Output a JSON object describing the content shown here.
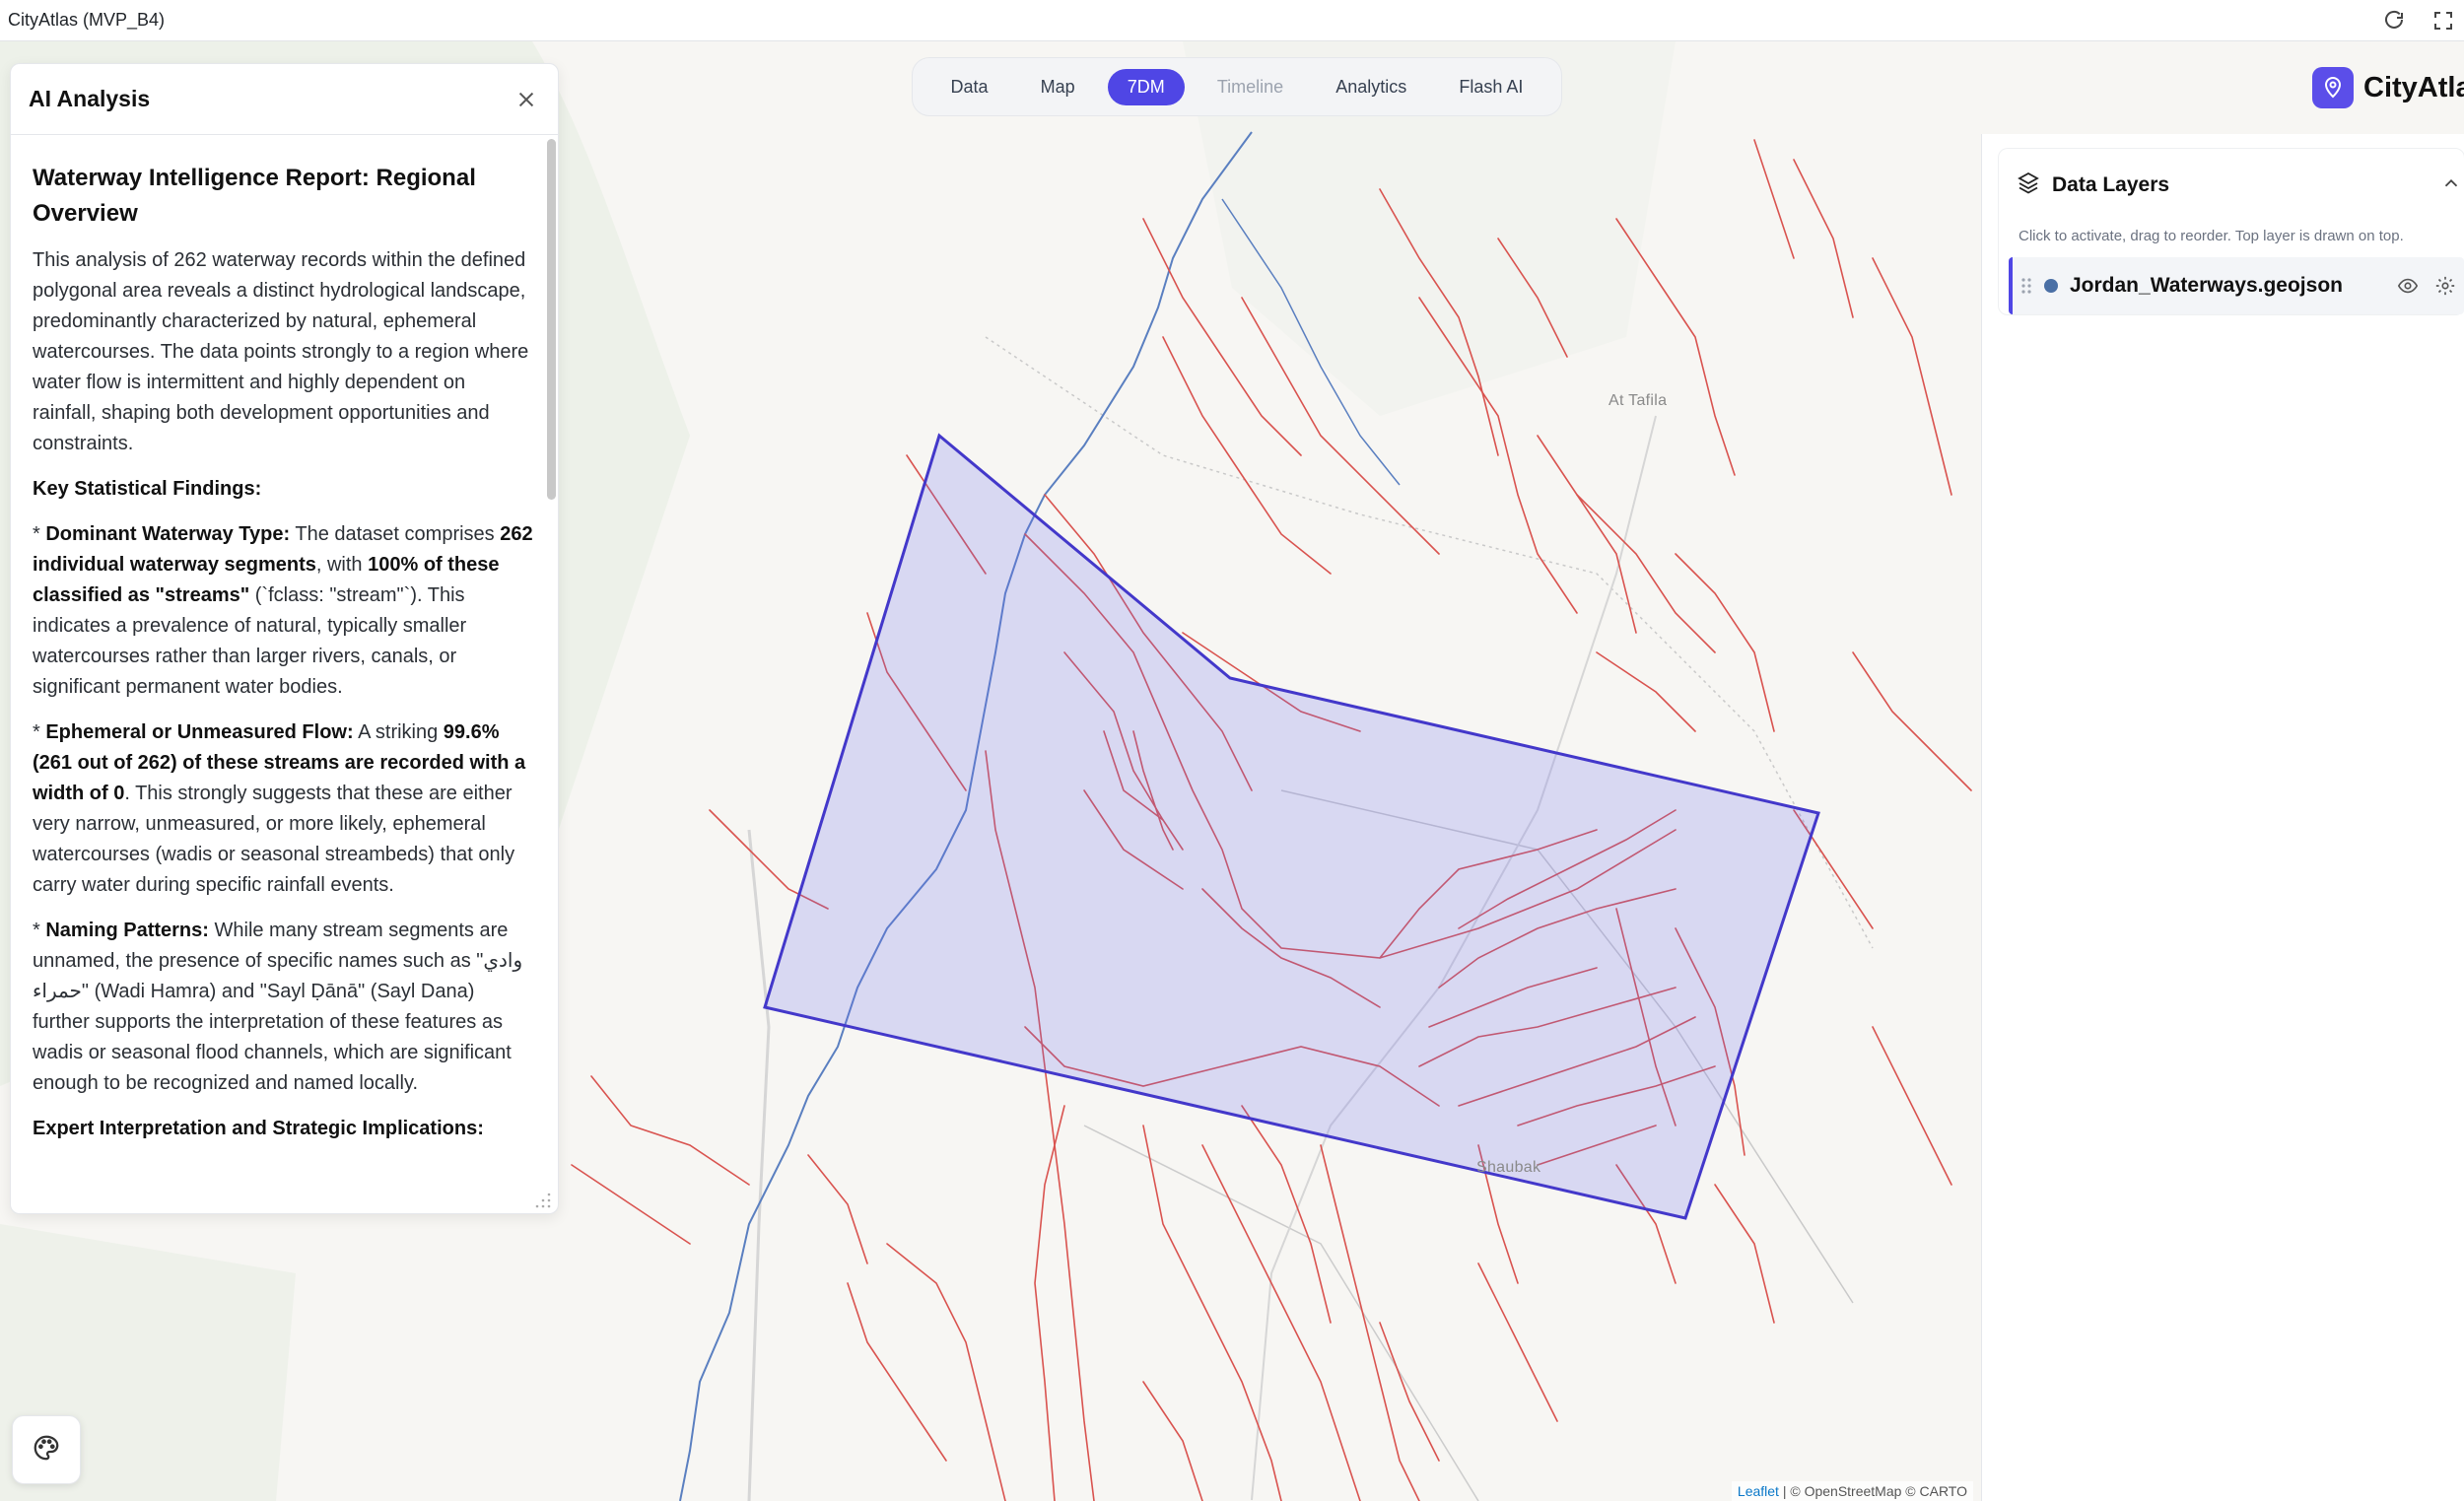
{
  "window": {
    "title": "CityAtlas (MVP_B4)"
  },
  "nav": {
    "tabs": [
      {
        "label": "Data"
      },
      {
        "label": "Map"
      },
      {
        "label": "7DM"
      },
      {
        "label": "Timeline"
      },
      {
        "label": "Analytics"
      },
      {
        "label": "Flash AI"
      }
    ],
    "active": "7DM",
    "disabled": "Timeline"
  },
  "brand": {
    "name": "CityAtlas",
    "accent": "#5b4ee9"
  },
  "ai_panel": {
    "title": "AI Analysis",
    "report_title": "Waterway Intelligence Report: Regional Overview",
    "intro": "This analysis of 262 waterway records within the defined polygonal area reveals a distinct hydrological landscape, predominantly characterized by natural, ephemeral watercourses. The data points strongly to a region where water flow is intermittent and highly dependent on rainfall, shaping both development opportunities and constraints.",
    "findings_heading": "Key Statistical Findings:",
    "finding1_label": "Dominant Waterway Type:",
    "finding1_a": " The dataset comprises ",
    "finding1_b": "262 individual waterway segments",
    "finding1_c": ", with ",
    "finding1_d": "100% of these classified as \"streams\"",
    "finding1_e": " (`fclass: \"stream\"`). This indicates a prevalence of natural, typically smaller watercourses rather than larger rivers, canals, or significant permanent water bodies.",
    "finding2_label": "Ephemeral or Unmeasured Flow:",
    "finding2_a": " A striking ",
    "finding2_b": "99.6% (261 out of 262) of these streams are recorded with a width of 0",
    "finding2_c": ". This strongly suggests that these are either very narrow, unmeasured, or more likely, ephemeral watercourses (wadis or seasonal streambeds) that only carry water during specific rainfall events.",
    "finding3_label": "Naming Patterns:",
    "finding3_a": " While many stream segments are unnamed, the presence of specific names such as \"وادي حمراء\" (Wadi Hamra) and \"Sayl Ḍānā\" (Sayl Dana) further supports the interpretation of these features as wadis or seasonal flood channels, which are significant enough to be recognized and named locally.",
    "bullet": "* ",
    "expert_heading": "Expert Interpretation and Strategic Implications:"
  },
  "data_layers": {
    "title": "Data Layers",
    "hint": "Click to activate, drag to reorder. Top layer is drawn on top.",
    "layers": [
      {
        "name": "Jordan_Waterways.geojson",
        "color": "#4a6fa5"
      }
    ]
  },
  "map": {
    "labels": [
      {
        "text": "At Tafila"
      },
      {
        "text": "Shaubak"
      }
    ],
    "polygon_color": "#4338ca",
    "waterway_color": "#d9534f",
    "attribution_link": "Leaflet",
    "attribution_text": " | © OpenStreetMap © CARTO"
  }
}
